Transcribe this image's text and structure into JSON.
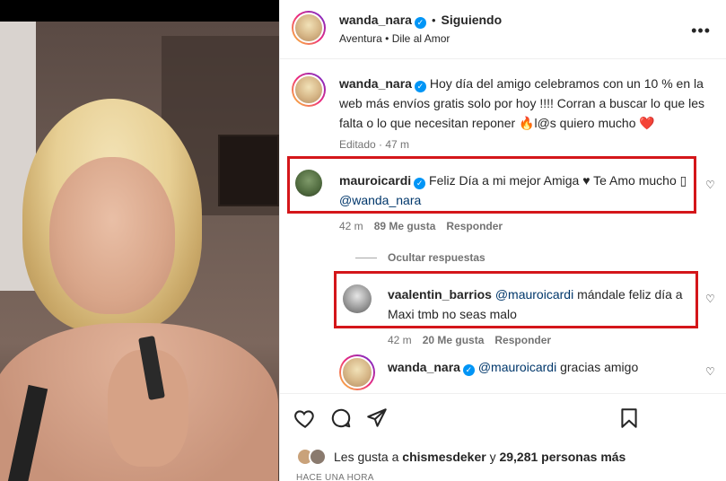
{
  "post": {
    "author": "wanda_nara",
    "follow_status": "Siguiendo",
    "audio_artist": "Aventura",
    "audio_song": "Dile al Amor",
    "caption": "Hoy día del amigo celebramos con un 10 % en la web más envíos gratis solo por hoy !!!! Corran a buscar lo que les falta o lo que necesitan reponer 🔥l@s quiero mucho ❤️",
    "caption_edited": "Editado",
    "caption_time": "47 m"
  },
  "comments": [
    {
      "user": "mauroicardi",
      "text": "Feliz Día a mi mejor Amiga ♥ Te Amo mucho ▯",
      "mention": "@wanda_nara",
      "time": "42 m",
      "likes": "89 Me gusta",
      "reply": "Responder"
    }
  ],
  "replies_toggle": "Ocultar respuestas",
  "replies": [
    {
      "user": "vaalentin_barrios",
      "mention": "@mauroicardi",
      "text": "mándale feliz día a",
      "text2": "Maxi tmb no seas malo",
      "time": "42 m",
      "likes": "20 Me gusta",
      "reply": "Responder"
    },
    {
      "user": "wanda_nara",
      "mention": "@mauroicardi",
      "text": "gracias amigo"
    }
  ],
  "footer": {
    "likes_prefix": "Les gusta a",
    "likes_user": "chismesdeker",
    "likes_middle": "y",
    "likes_count": "29,281 personas más",
    "time_ago": "HACE UNA HORA"
  },
  "icons": {
    "like": "heart-icon",
    "comment": "comment-icon",
    "share": "share-icon",
    "save": "bookmark-icon",
    "more": "more-options-icon"
  },
  "colors": {
    "highlight_box": "#d4161a",
    "verified": "#0095f6",
    "mention": "#00376b"
  }
}
